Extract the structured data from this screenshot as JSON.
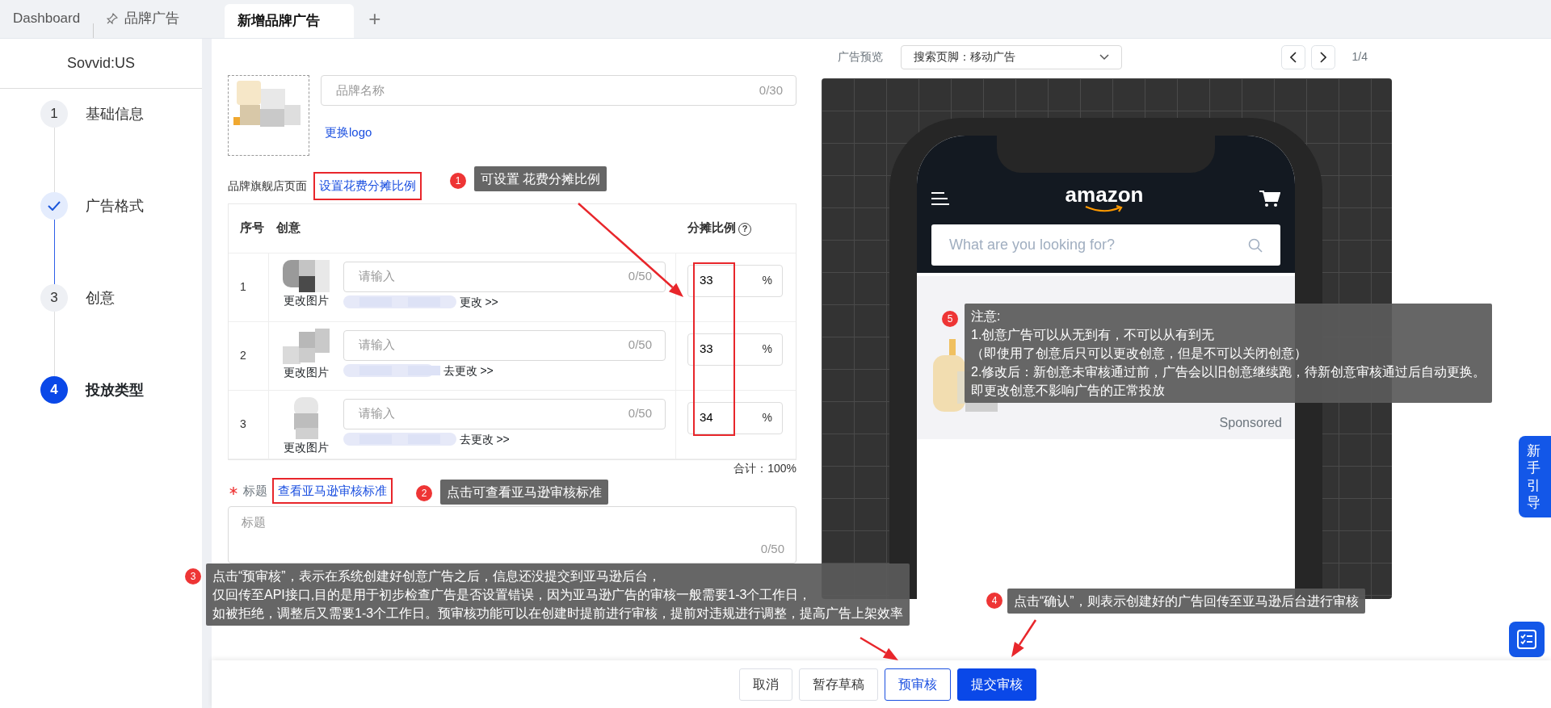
{
  "tabs": [
    {
      "label": "Dashboard",
      "selected": false,
      "pinned": false
    },
    {
      "label": "品牌广告",
      "selected": false,
      "pinned": true
    },
    {
      "label": "新增品牌广告",
      "selected": true,
      "pinned": false
    }
  ],
  "add_tab": "+",
  "sidebar": {
    "account": "Sovvid:US",
    "steps": [
      {
        "number": "1",
        "label": "基础信息",
        "done": false,
        "current": false
      },
      {
        "label": "广告格式",
        "done": true,
        "current": false
      },
      {
        "number": "3",
        "label": "创意",
        "done": false,
        "current": false
      },
      {
        "number": "4",
        "label": "投放类型",
        "done": false,
        "current": true
      }
    ]
  },
  "form": {
    "brand_name": {
      "placeholder": "品牌名称",
      "counter": "0/30"
    },
    "change_logo": "更换logo",
    "store_label": "品牌旗舰店页面",
    "store_link": "设置花费分摊比例",
    "table": {
      "columns": [
        "序号",
        "创意",
        "分摊比例"
      ],
      "help_mark": "?",
      "rows": [
        {
          "index": "1",
          "change_image": "更改图片",
          "placeholder": "请输入",
          "counter": "0/50",
          "link": "更改 >>",
          "ratio": "33",
          "unit": "%"
        },
        {
          "index": "2",
          "change_image": "更改图片",
          "placeholder": "请输入",
          "counter": "0/50",
          "link": "去更改 >>",
          "ratio": "33",
          "unit": "%"
        },
        {
          "index": "3",
          "change_image": "更改图片",
          "placeholder": "请输入",
          "counter": "0/50",
          "link": "去更改 >>",
          "ratio": "34",
          "unit": "%"
        }
      ]
    },
    "total": "合计：100%",
    "title_required": true,
    "title_label": "标题",
    "title_link": "查看亚马逊审核标准",
    "title_field": {
      "placeholder": "标题",
      "counter": "0/50"
    }
  },
  "preview": {
    "label": "广告预览",
    "select": "搜索页脚：移动广告",
    "page": "1/4",
    "logo": "amazon",
    "search_placeholder": "What are you looking for?",
    "sponsored": "Sponsored"
  },
  "guide_tab": "新手引导",
  "footer_buttons": [
    {
      "label": "取消",
      "kind": "default"
    },
    {
      "label": "暂存草稿",
      "kind": "default"
    },
    {
      "label": "预审核",
      "kind": "outline"
    },
    {
      "label": "提交审核",
      "kind": "primary"
    }
  ],
  "annotations": [
    {
      "number": "1",
      "lines": [
        "可设置 花费分摊比例"
      ]
    },
    {
      "number": "2",
      "lines": [
        "点击可查看亚马逊审核标准"
      ]
    },
    {
      "number": "3",
      "lines": [
        "点击“预审核”，表示在系统创建好创意广告之后，信息还没提交到亚马逊后台，",
        "仅回传至API接口,目的是用于初步检查广告是否设置错误，因为亚马逊广告的审核一般需要1-3个工作日，",
        "如被拒绝，调整后又需要1-3个工作日。预审核功能可以在创建时提前进行审核，提前对违规进行调整，提高广告上架效率"
      ]
    },
    {
      "number": "4",
      "lines": [
        "点击“确认”，则表示创建好的广告回传至亚马逊后台进行审核"
      ]
    },
    {
      "number": "5",
      "lines": [
        "注意:",
        "1.创意广告可以从无到有，不可以从有到无",
        "（即使用了创意后只可以更改创意，但是不可以关闭创意）",
        "2.修改后：新创意未审核通过前，广告会以旧创意继续跑，待新创意审核通过后自动更换。",
        "即更改创意不影响广告的正常投放"
      ]
    }
  ]
}
